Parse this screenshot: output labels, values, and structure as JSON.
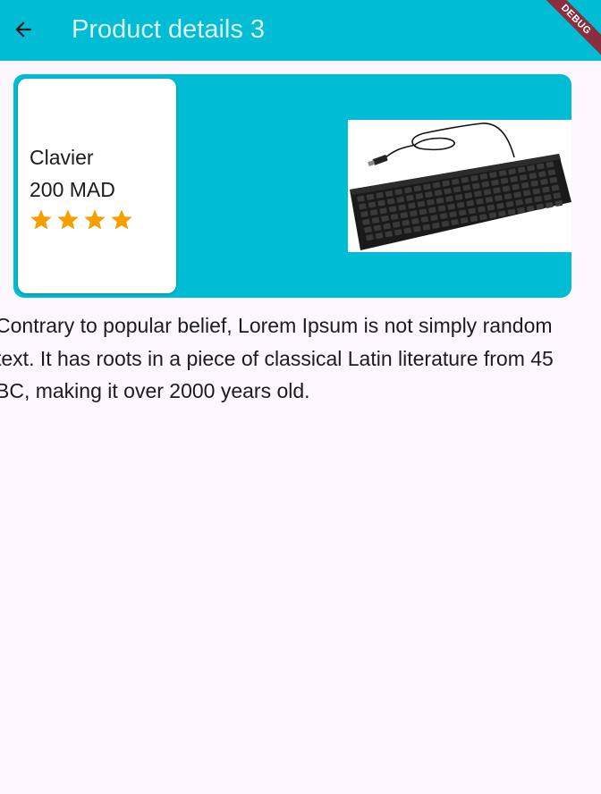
{
  "app_bar": {
    "title": "Product details 3",
    "back_icon": "arrow-back-icon",
    "background_color": "#00BCD4"
  },
  "debug_banner": {
    "label": "DEBUG"
  },
  "product": {
    "name": "Clavier",
    "price": "200 MAD",
    "rating_stars": 4,
    "star_color": "#F5A000",
    "card_color": "#00BCD4",
    "image_icon": "keyboard-image"
  },
  "description": "Contrary to popular belief, Lorem Ipsum is not simply random text. It has roots in a piece of classical Latin literature from 45 BC, making it over 2000 years old."
}
